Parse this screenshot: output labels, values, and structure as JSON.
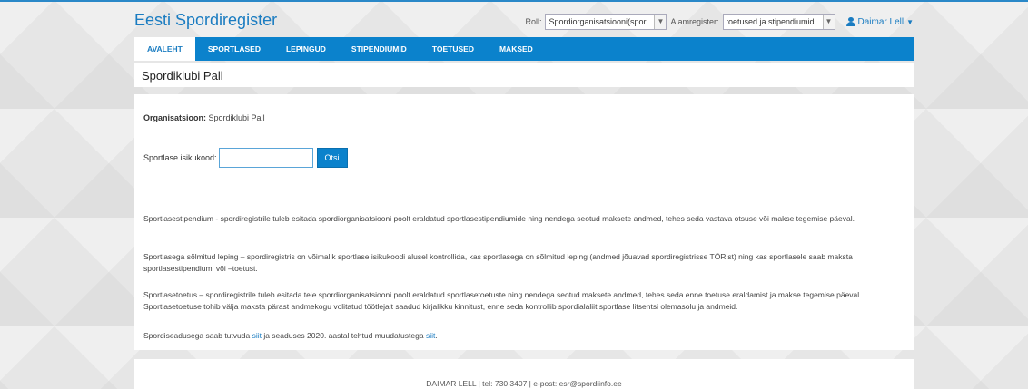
{
  "app": {
    "title": "Eesti Spordiregister"
  },
  "header": {
    "roll_label": "Roll:",
    "roll_value": "Spordiorganisatsiooni(spor",
    "alamregister_label": "Alamregister:",
    "alamregister_value": "toetused ja stipendiumid",
    "user_name": "Daimar Lell"
  },
  "nav": {
    "tabs": [
      {
        "label": "AVALEHT",
        "active": true
      },
      {
        "label": "SPORTLASED"
      },
      {
        "label": "LEPINGUD"
      },
      {
        "label": "STIPENDIUMID"
      },
      {
        "label": "TOETUSED"
      },
      {
        "label": "MAKSED"
      }
    ]
  },
  "page": {
    "title": "Spordiklubi Pall"
  },
  "main": {
    "org_label": "Organisatsioon:",
    "org_value": "Spordiklubi Pall",
    "search_label": "Sportlase isikukood:",
    "search_value": "",
    "search_button": "Otsi",
    "para1": "Sportlasestipendium - spordiregistrile tuleb esitada spordiorganisatsiooni poolt eraldatud sportlasestipendiumide ning nendega seotud maksete andmed, tehes seda vastava otsuse või makse tegemise päeval.",
    "para2": "Sportlasega sõlmitud leping – spordiregistris on võimalik sportlase isikukoodi alusel kontrollida, kas sportlasega on sõlmitud leping (andmed jõuavad spordiregistrisse TÖRist) ning kas sportlasele saab maksta sportlasestipendiumi või –toetust.",
    "para3": "Sportlasetoetus – spordiregistrile tuleb esitada teie spordiorganisatsiooni poolt eraldatud sportlasetoetuste ning nendega seotud maksete andmed, tehes seda enne toetuse eraldamist ja makse tegemise päeval. Sportlasetoetuse tohib välja maksta pärast andmekogu volitatud töötlejalt saadud kirjalikku kinnitust, enne seda kontrollib spordialaliit sportlase litsentsi olemasolu ja andmeid.",
    "para4_pre": "Spordiseadusega saab tutvuda ",
    "para4_link1": "siit",
    "para4_mid": " ja seaduses 2020. aastal tehtud muudatustega ",
    "para4_link2": "siit",
    "para4_post": "."
  },
  "footer": {
    "text": "DAIMAR LELL | tel: 730 3407 | e-post: esr@spordiinfo.ee"
  },
  "colors": {
    "accent": "#0b82cc",
    "brand": "#1a7cc1"
  },
  "icons": {
    "user": "user-icon",
    "dropdown": "chevron-down-icon"
  }
}
